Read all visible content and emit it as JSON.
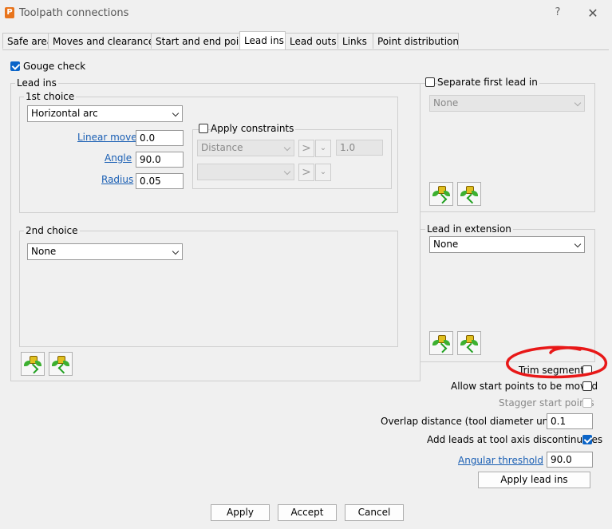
{
  "window": {
    "title": "Toolpath connections",
    "app_icon_letter": "P",
    "help": "?",
    "close": "✕"
  },
  "tabs": [
    {
      "label": "Safe area"
    },
    {
      "label": "Moves and clearances"
    },
    {
      "label": "Start and end point"
    },
    {
      "label": "Lead ins"
    },
    {
      "label": "Lead outs"
    },
    {
      "label": "Links"
    },
    {
      "label": "Point distribution"
    }
  ],
  "gouge_check": {
    "label": "Gouge check",
    "checked": true
  },
  "lead_ins": {
    "group_label": "Lead ins",
    "first_choice": {
      "label": "1st choice",
      "type_value": "Horizontal arc",
      "linear_move_label": "Linear move",
      "linear_move_value": "0.0",
      "angle_label": "Angle",
      "angle_value": "90.0",
      "radius_label": "Radius",
      "radius_value": "0.05",
      "apply_constraints_label": "Apply constraints",
      "constraint1_value": "Distance",
      "constraint1_op": ">",
      "constraint1_num": "1.0",
      "constraint2_value": "",
      "constraint2_op": ">"
    },
    "second_choice": {
      "label": "2nd choice",
      "type_value": "None"
    }
  },
  "separate_first": {
    "label": "Separate first lead in",
    "value": "None"
  },
  "extension": {
    "label": "Lead in extension",
    "value": "None"
  },
  "options": {
    "trim_segments": "Trim segments",
    "allow_start_points": "Allow start points to be moved",
    "stagger_start_points": "Stagger start points",
    "overlap_label": "Overlap distance (tool diameter units)",
    "overlap_value": "0.1",
    "add_leads_label": "Add leads at tool axis discontinuities",
    "angular_threshold_label": "Angular threshold",
    "angular_threshold_value": "90.0",
    "apply_lead_ins": "Apply lead ins"
  },
  "footer": {
    "apply": "Apply",
    "accept": "Accept",
    "cancel": "Cancel"
  },
  "colors": {
    "accent": "#0a64c8",
    "annotation": "#e81818"
  }
}
